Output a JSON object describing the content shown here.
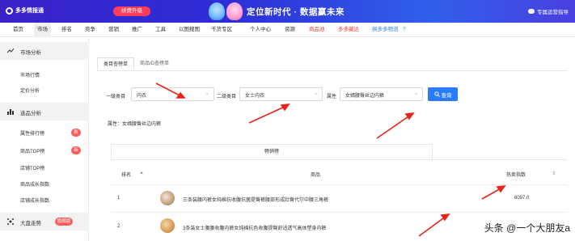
{
  "header": {
    "logo_text": "多多情报通",
    "upgrade_label": "续费升级",
    "slogan": "定位新时代 · 数据赢未来",
    "helper_label": "专属运营指导"
  },
  "nav": {
    "items": [
      {
        "label": "首页"
      },
      {
        "label": "市场"
      },
      {
        "label": "排名"
      },
      {
        "label": "竞争"
      },
      {
        "label": "营销"
      },
      {
        "label": "推广"
      },
      {
        "label": "工具"
      },
      {
        "label": "以图搜图"
      },
      {
        "label": "干货专区"
      },
      {
        "label": "个人中心"
      },
      {
        "label": "资源"
      },
      {
        "label": "商品池"
      },
      {
        "label": "多多藏达"
      },
      {
        "label": "拼多多物流"
      }
    ],
    "help_glyph": "?"
  },
  "sidebar": {
    "group1": "市场分析",
    "group1_items": [
      "市场行情",
      "定价分析"
    ],
    "group2": "选品分析",
    "group2_items": [
      "属性排行榜",
      "商品TOP榜",
      "店铺TOP榜",
      "商品成长指数",
      "店铺成长指数"
    ],
    "badge_new": "新",
    "group3": "大盘走势",
    "group3_badge": "旗舰版"
  },
  "tabs": [
    "类目查榜单",
    "商品ID查榜单"
  ],
  "filters": {
    "l1_label": "一级类目",
    "l1_value": "内衣",
    "l2_label": "二级类目",
    "l2_value": "女士内衣",
    "attr_label": "属性",
    "attr_value": "女嫣腰臀丝边内裤",
    "query_label": "查询"
  },
  "attr_line": "属性：女嫣腰臀丝边内裤",
  "table": {
    "tab_label": "畅销榜",
    "col_rank": "排名",
    "col_product": "商品",
    "col_hot": "热卖指数",
    "rows": [
      {
        "rank": "1",
        "product": "三条装腰内裤女纯棉抗收腹抗菌提臀裤腰部形成肚臀代尔中腰三角裤",
        "hot": "6097.0"
      },
      {
        "rank": "2",
        "product": "3条装女士腰腰收腹内裤女纯棉抗色收腹提臀舒适透气高体塑身内裤",
        "hot": ""
      }
    ]
  },
  "watermark": "头条 @一个大朋友a"
}
